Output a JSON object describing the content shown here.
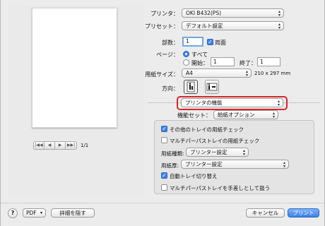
{
  "preview": {
    "pager": {
      "first": "|◀◀",
      "prev": "◀",
      "next": "▶",
      "last": "▶▶|"
    },
    "page_count": "1/1"
  },
  "form": {
    "printer_label": "プリンタ：",
    "printer_value": "OKI B432(PS)",
    "preset_label": "プリセット：",
    "preset_value": "デフォルト設定",
    "copies_label": "部数：",
    "copies_value": "1",
    "collate_label": "両面",
    "pages_label": "ページ：",
    "all_label": "すべて",
    "from_label": "開始：",
    "from_value": "1",
    "to_label": "終了：",
    "to_value": "1",
    "paper_label": "用紙サイズ：",
    "paper_value": "A4",
    "paper_dims": "210 x 297 mm",
    "orientation_label": "方向："
  },
  "section": {
    "menu_value": "プリンタの機能",
    "feature_set_label": "機能セット：",
    "feature_set_value": "給紙オプション"
  },
  "options": {
    "other_tray_check": "その他のトレイの用紙チェック",
    "mp_tray_check": "マルチパーパストレイの用紙チェック",
    "media_type_label": "用紙種類:",
    "media_type_value": "プリンター設定",
    "media_weight_label": "用紙厚:",
    "media_weight_value": "プリンター設定",
    "auto_tray_switch": "自動トレイ切り替え",
    "mp_manual": "マルチパーパストレイを手差しとして扱う"
  },
  "bottom": {
    "help": "?",
    "pdf": "PDF",
    "hide_details": "詳細を隠す",
    "cancel": "キャンセル",
    "print": "プリント"
  },
  "colors": {
    "accent": "#3f83e8",
    "highlight": "#d6262a"
  }
}
